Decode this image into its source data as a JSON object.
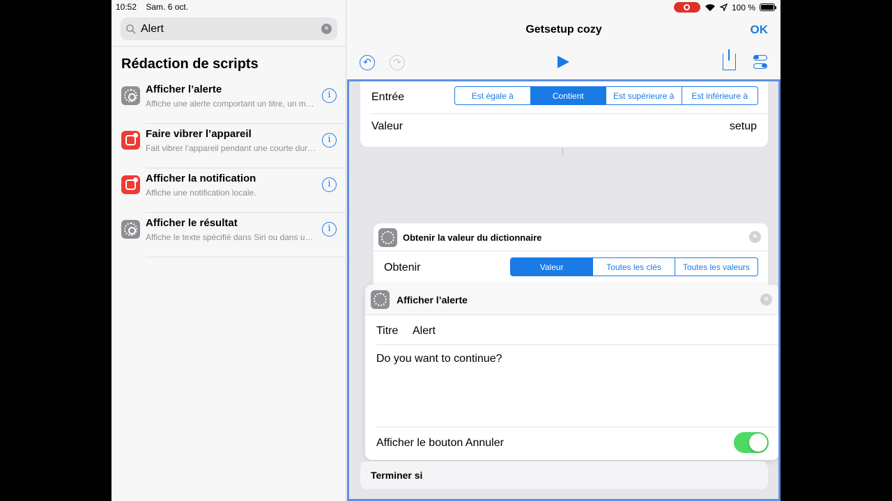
{
  "status_bar": {
    "time": "10:52",
    "date": "Sam. 6 oct.",
    "battery": "100 %"
  },
  "search": {
    "value": "Alert"
  },
  "sidebar": {
    "section_title": "Rédaction de scripts",
    "items": [
      {
        "title": "Afficher l’alerte",
        "subtitle": "Affiche une alerte comportant un titre, un message...",
        "icon": "gear-icon"
      },
      {
        "title": "Faire vibrer l’appareil",
        "subtitle": "Fait vibrer l’appareil pendant une courte durée.",
        "icon": "notification-icon"
      },
      {
        "title": "Afficher la notification",
        "subtitle": "Affiche une notification locale.",
        "icon": "notification-icon"
      },
      {
        "title": "Afficher le résultat",
        "subtitle": "Affiche le texte spécifié dans Siri ou dans une alerte.",
        "icon": "gear-icon"
      }
    ],
    "info_glyph": "i"
  },
  "editor": {
    "title": "Getsetup cozy",
    "ok_label": "OK",
    "undo_glyph": "↶",
    "redo_glyph": "↷"
  },
  "filter_card": {
    "entry_label": "Entrée",
    "options": [
      "Est égale à",
      "Contient",
      "Est supérieure à",
      "Est inférieure à"
    ],
    "selected": "Contient",
    "value_label": "Valeur",
    "value": "setup"
  },
  "dict_card": {
    "title": "Obtenir la valeur du dictionnaire",
    "get_label": "Obtenir",
    "options": [
      "Valeur",
      "Toutes les clés",
      "Toutes les valeurs"
    ],
    "selected": "Valeur"
  },
  "alert_card": {
    "title": "Afficher l’alerte",
    "title_label": "Titre",
    "title_value": "Alert",
    "message": "Do you want to continue?",
    "cancel_label": "Afficher le bouton Annuler",
    "cancel_enabled": true
  },
  "end_card": {
    "label": "Terminer si"
  },
  "colors": {
    "accent": "#1a7ae6",
    "toggle_on": "#4cd964",
    "selection_border": "#5f8fe6",
    "record": "#e0302a"
  }
}
